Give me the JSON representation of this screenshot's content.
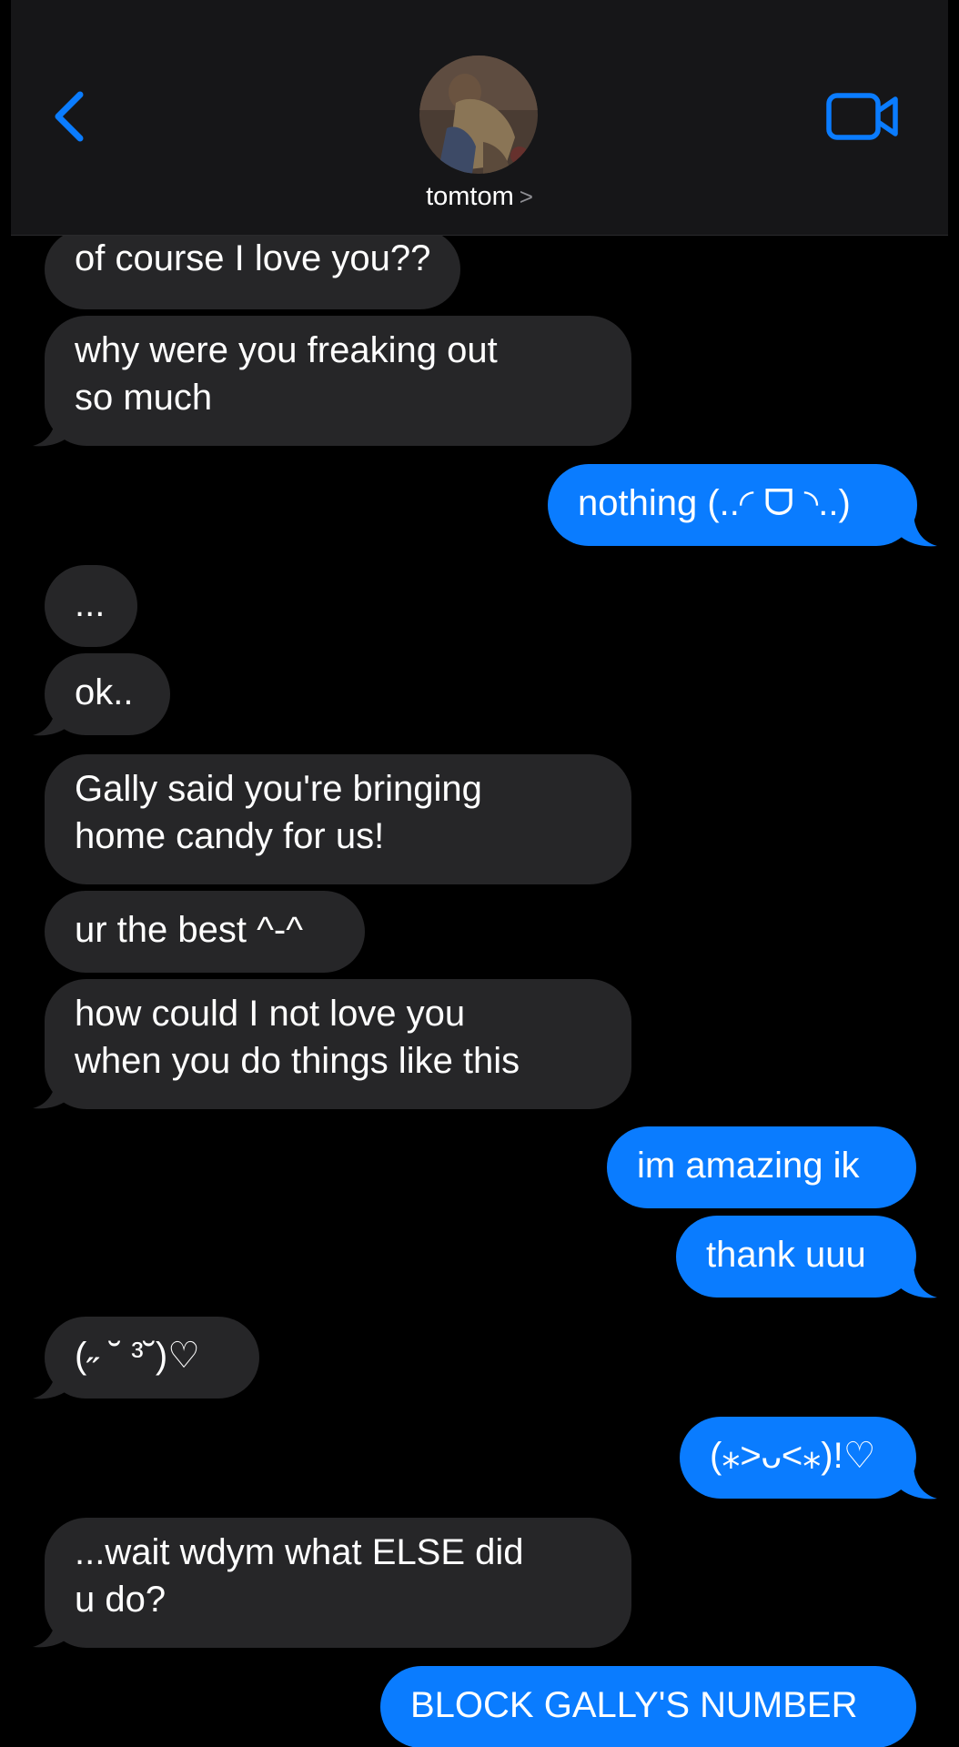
{
  "header": {
    "back_icon": "chevron-left-icon",
    "contact_name": "tomtom",
    "contact_chevron": ">",
    "video_icon": "video-camera-icon",
    "accent_color": "#0a7cff"
  },
  "colors": {
    "incoming_bubble": "#262628",
    "outgoing_bubble": "#0a7cff",
    "background": "#000000"
  },
  "messages": [
    {
      "sender": "them",
      "text": "of course I love you??"
    },
    {
      "sender": "them",
      "text": "why were you freaking out\nso much"
    },
    {
      "sender": "me",
      "text": "nothing (..◜ ᗜ ◝..)"
    },
    {
      "sender": "them",
      "text": "..."
    },
    {
      "sender": "them",
      "text": "ok.."
    },
    {
      "sender": "them",
      "text": "Gally said you're bringing\nhome candy for us!"
    },
    {
      "sender": "them",
      "text": "ur the best ^-^"
    },
    {
      "sender": "them",
      "text": "how could I not love you\nwhen you do things like this"
    },
    {
      "sender": "me",
      "text": "im amazing ik"
    },
    {
      "sender": "me",
      "text": "thank uuu"
    },
    {
      "sender": "them",
      "text": "(˶ ˘ ³˘)♡"
    },
    {
      "sender": "me",
      "text": "(⁎˃ᴗ˂⁎)!♡"
    },
    {
      "sender": "them",
      "text": "...wait wdym what ELSE did\nu do?"
    },
    {
      "sender": "me",
      "text": "BLOCK GALLY'S NUMBER"
    }
  ]
}
